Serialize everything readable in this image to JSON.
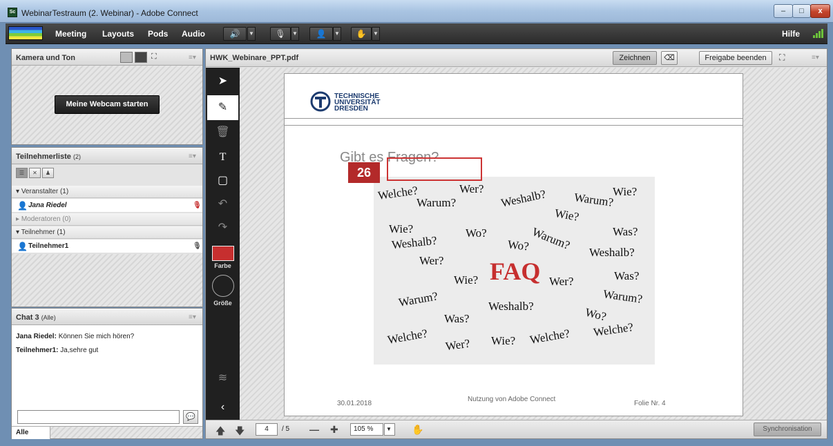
{
  "window": {
    "title": "WebinarTestraum (2. Webinar) - Adobe Connect",
    "app_icon": "Sc",
    "min": "–",
    "max": "□",
    "close": "x"
  },
  "menu": {
    "items": [
      "Meeting",
      "Layouts",
      "Pods",
      "Audio"
    ],
    "help": "Hilfe"
  },
  "camera_pod": {
    "title": "Kamera und Ton",
    "webcam_button": "Meine Webcam starten"
  },
  "participants_pod": {
    "title": "Teilnehmerliste",
    "count": "(2)",
    "groups": {
      "hosts": "Veranstalter (1)",
      "presenters": "Moderatoren (0)",
      "participants": "Teilnehmer (1)"
    },
    "host_name": "Jana Riedel",
    "participant_name": "Teilnehmer1"
  },
  "chat_pod": {
    "title": "Chat 3",
    "scope": "(Alle)",
    "messages": [
      {
        "sender": "Jana Riedel:",
        "text": "Können Sie mich hören?"
      },
      {
        "sender": "Teilnehmer1:",
        "text": "Ja,sehre gut"
      }
    ],
    "recipient": "Alle"
  },
  "share_pod": {
    "filename": "HWK_Webinare_PPT.pdf",
    "draw_button": "Zeichnen",
    "stop_share_button": "Freigabe beenden",
    "draw_tools": {
      "color_label": "Farbe",
      "size_label": "Größe",
      "text_tool": "T"
    },
    "accent_color": "#c62f2f",
    "footer": {
      "page": "4",
      "total": "/ 5",
      "zoom": "105 %",
      "sync_button": "Synchronisation"
    }
  },
  "slide": {
    "logo_line1": "TECHNISCHE",
    "logo_line2": "UNIVERSITÄT",
    "logo_line3": "DRESDEN",
    "title": "Gibt es Fragen?",
    "badge": "26",
    "faq_center": "FAQ",
    "words": [
      "Welche?",
      "Wer?",
      "Weshalb?",
      "Warum?",
      "Wie?",
      "Warum?",
      "Wie?",
      "Wie?",
      "Wo?",
      "Warum?",
      "Was?",
      "Weshalb?",
      "Wo?",
      "Weshalb?",
      "Wer?",
      "Wie?",
      "Wer?",
      "Was?",
      "Warum?",
      "Weshalb?",
      "Warum?",
      "Was?",
      "Wo?",
      "Welche?",
      "Wer?",
      "Wie?",
      "Welche?",
      "Welche?"
    ],
    "footer_date": "30.01.2018",
    "footer_center": "Nutzung von Adobe Connect",
    "footer_right": "Folie Nr. 4"
  }
}
